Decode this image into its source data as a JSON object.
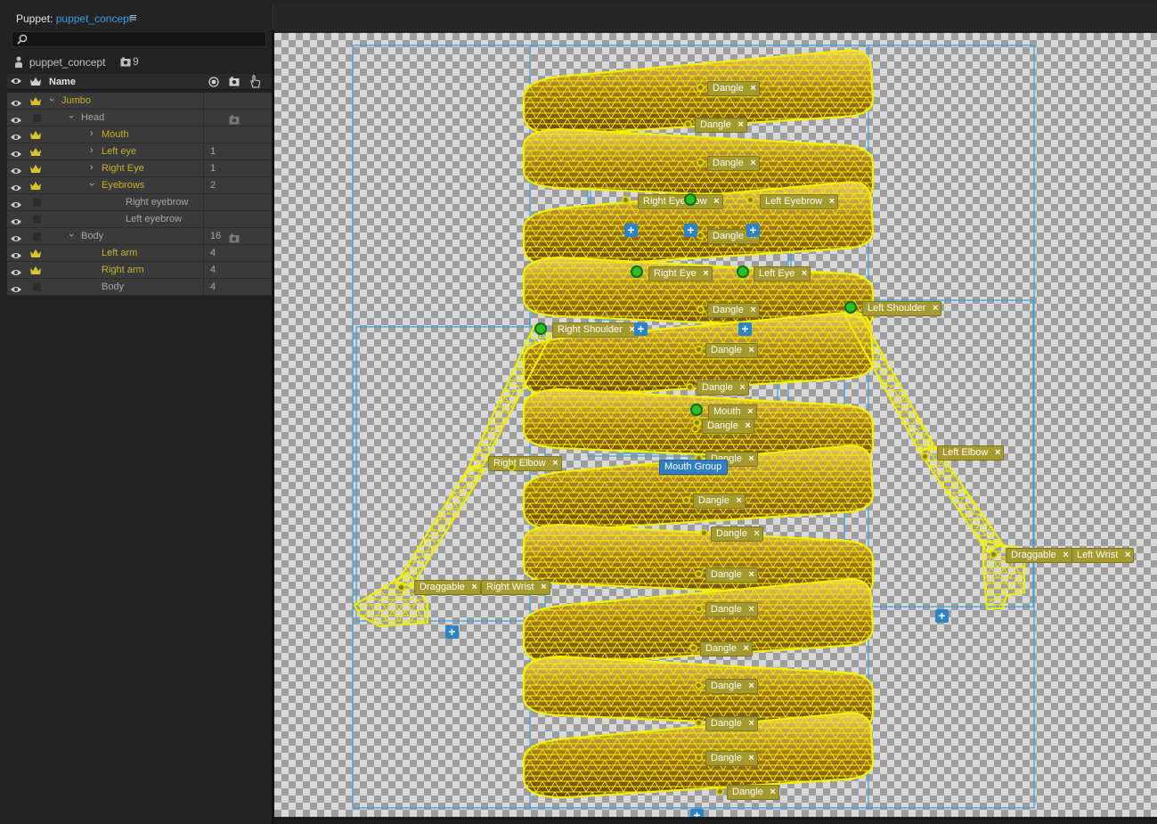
{
  "window": {
    "panel_label": "Puppet:",
    "document_name": "puppet_concept",
    "menu_glyph": "≡"
  },
  "panel": {
    "search": {
      "placeholder": ""
    },
    "puppet_name": "puppet_concept",
    "camera_count": "9",
    "header": {
      "name": "Name"
    },
    "rows": [
      {
        "chev": "›",
        "expanded": true,
        "label": "Jumbo",
        "count": "",
        "crown": true,
        "color": "gold",
        "indent": 0,
        "cam": false
      },
      {
        "chev": "›",
        "expanded": true,
        "label": "Head",
        "count": "",
        "crown": false,
        "color": "grey",
        "indent": 1,
        "cam": true
      },
      {
        "chev": "›",
        "expanded": false,
        "label": "Mouth",
        "count": "",
        "crown": true,
        "color": "gold",
        "indent": 2,
        "cam": false
      },
      {
        "chev": "›",
        "expanded": false,
        "label": "Left eye",
        "count": "1",
        "crown": true,
        "color": "gold",
        "indent": 2,
        "cam": false
      },
      {
        "chev": "›",
        "expanded": false,
        "label": "Right Eye",
        "count": "1",
        "crown": true,
        "color": "gold",
        "indent": 2,
        "cam": false
      },
      {
        "chev": "›",
        "expanded": true,
        "label": "Eyebrows",
        "count": "2",
        "crown": true,
        "color": "gold",
        "indent": 2,
        "cam": false
      },
      {
        "chev": "",
        "expanded": false,
        "label": "Right eyebrow",
        "count": "",
        "crown": false,
        "color": "grey",
        "indent": 3,
        "cam": false
      },
      {
        "chev": "",
        "expanded": false,
        "label": "Left eyebrow",
        "count": "",
        "crown": false,
        "color": "grey",
        "indent": 3,
        "cam": false
      },
      {
        "chev": "›",
        "expanded": true,
        "label": "Body",
        "count": "16",
        "crown": false,
        "color": "grey",
        "indent": 1,
        "cam": true
      },
      {
        "chev": "",
        "expanded": false,
        "label": "Left arm",
        "count": "4",
        "crown": true,
        "color": "gold",
        "indent": 2,
        "cam": false
      },
      {
        "chev": "",
        "expanded": false,
        "label": "Right arm",
        "count": "4",
        "crown": true,
        "color": "gold",
        "indent": 2,
        "cam": false
      },
      {
        "chev": "",
        "expanded": false,
        "label": "Body",
        "count": "4",
        "crown": false,
        "color": "grey",
        "indent": 2,
        "cam": false
      }
    ]
  },
  "canvas": {
    "tags": {
      "dangle": "Dangle",
      "right_eyebrow": "Right Eyebrow",
      "left_eyebrow": "Left Eyebrow",
      "right_eye": "Right Eye",
      "left_eye": "Left Eye",
      "left_shoulder": "Left Shoulder",
      "right_shoulder": "Right Shoulder",
      "mouth": "Mouth",
      "mouth_group": "Mouth Group",
      "right_elbow": "Right Elbow",
      "left_elbow": "Left Elbow",
      "draggable": "Draggable",
      "left_wrist": "Left Wrist",
      "right_wrist": "Right Wrist"
    },
    "remove_glyph": "×",
    "plus_glyph": "+"
  },
  "colors": {
    "accent_blue": "#3f9de3",
    "label_gold": "#c9b02e",
    "mesh_yellow": "#f2f000",
    "tag_olive": "#a59a2e",
    "handle_green": "#2dbd24",
    "bbox_blue": "#3aa0d8"
  }
}
